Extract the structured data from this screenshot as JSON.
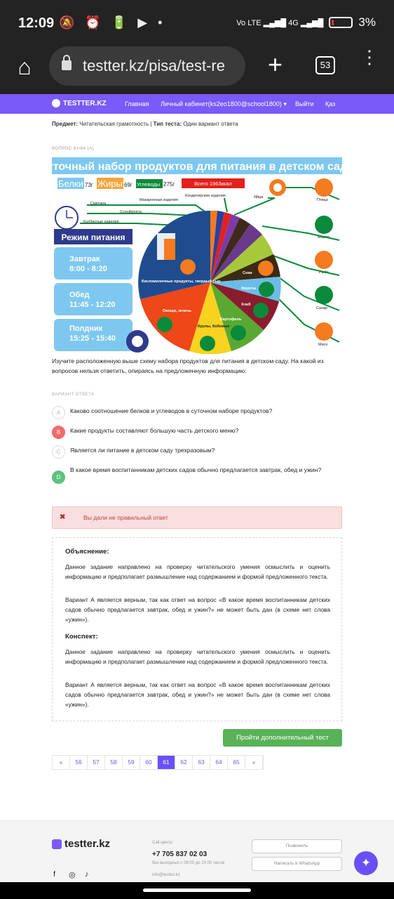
{
  "status_bar": {
    "time": "12:09",
    "icons": "🔕 ⏰ 🔋 ▶ •",
    "network": "Vo LTE ▂▄▆█ 4G ▂▄▆█",
    "battery": "3%"
  },
  "browser": {
    "url": "testter.kz/pisa/test-re",
    "tab_count": "53"
  },
  "nav": {
    "brand": "TESTTER.KZ",
    "links": [
      "Главная",
      "Личный кабинет(ks2eo1800@school1800) ▾",
      "Выйти",
      "Қаз"
    ]
  },
  "meta": {
    "subject_label": "Предмет:",
    "subject": "Читательская грамотность",
    "separator": "|",
    "type_label": "Тип теста:",
    "type": "Один вариант ответа"
  },
  "question": {
    "number": "ВОПРОС 61/84 (A)",
    "text": "Изучите расположенную выше схему набора продуктов для питания в детском саду. На какой из вопросов нельзя ответить, опираясь на предложенную информацию:"
  },
  "infographic": {
    "title": "суточный набор продуктов для питания в детском саду",
    "belki": "Белки",
    "belki_val": "73г",
    "zhiry": "Жиры",
    "zhiry_val": "69г",
    "uglevody": "Углеводы",
    "uglevody_val": "275г",
    "total": "Всего 1963ккал",
    "rezhim": "Режим питания",
    "meals": [
      {
        "name": "Завтрак",
        "time": "8:00 - 8:20"
      },
      {
        "name": "Обед",
        "time": "11:45 - 12:20"
      },
      {
        "name": "Полдник",
        "time": "15:25 - 15:40"
      }
    ],
    "labels": {
      "smetana": "Сметана",
      "makaron": "Макаронные изделия",
      "konditer": "Кондитерские изделия",
      "suhofrukty": "Сухофрукты",
      "kolbas": "Колбасные изделия",
      "yaica": "Яйца",
      "ptica": "Птица",
      "maslo": "Масло",
      "ryba": "Рыба",
      "sahar": "Сахар",
      "myaso": "Мясо",
      "kislomol": "Кисломолочные продукты, твердый сыр",
      "ovoshi": "Овощи, зелень",
      "krupy": "Крупы, бобовые",
      "kartofel": "Картофель",
      "hleb": "Хлеб",
      "soki": "Соки",
      "frukty": "Фрукты"
    },
    "colors": {
      "banner": "#7ec8f0",
      "meal_box": "#7ec8f0",
      "rezhim": "#2e3a8c",
      "green": "#0a8a3a",
      "orange": "#f47b20"
    }
  },
  "answers": {
    "label": "ВАРИАНТ ОТВЕТА",
    "options": [
      {
        "letter": "A",
        "text": "Каково соотношение белков и углеводов в суточном наборе продуктов?",
        "state": "none"
      },
      {
        "letter": "B",
        "text": "Какие продукты составляют большую часть детского меню?",
        "state": "wrong"
      },
      {
        "letter": "C",
        "text": "Является ли питание в детском саду трехразовым?",
        "state": "none"
      },
      {
        "letter": "D",
        "text": "В какое время воспитанникам детских садов обычно предлагается завтрак, обед и ужин?",
        "state": "right"
      }
    ]
  },
  "result": {
    "icon": "✖",
    "text": "Вы дали не правильный ответ"
  },
  "explanation": {
    "title": "Объяснение:",
    "p1": "Данное задание направлено на проверку читательского умения осмыслить и оценить информацию и предполагает размышление над содержанием и формой предложенного текста.",
    "p2": "Вариант А является верным, так как ответ на вопрос «В какое время воспитанникам детских садов обычно предлагается завтрак, обед и ужин?» не может быть дан (в схеме нет слова «ужин»).",
    "konspekt_title": "Конспект:",
    "p3": "Данное задание направлено на проверку читательского умения осмыслить и оценить информацию и предполагает размышление над содержанием и формой предложенного текста.",
    "p4": "Вариант А является верным, так как ответ на вопрос «В какое время воспитанникам детских садов обычно предлагается завтрак, обед и ужин?» не может быть дан (в схеме нет слова «ужин»)."
  },
  "actions": {
    "more_test": "Пройти дополнительный тест"
  },
  "pagination": {
    "pages": [
      "«",
      "56",
      "57",
      "58",
      "59",
      "60",
      "61",
      "62",
      "63",
      "64",
      "65",
      "»"
    ],
    "active": "61"
  },
  "footer": {
    "brand": "testter.kz",
    "call_label": "Call-центр:",
    "phone": "+7 705 837 02 03",
    "hours": "без выходных с 08:00 до 20:00 часов",
    "email": "info@testter.kz",
    "call_button": "Позвонить",
    "whatsapp_button": "Написать в WhatsApp",
    "social": [
      "f",
      "◎",
      "♪"
    ]
  }
}
